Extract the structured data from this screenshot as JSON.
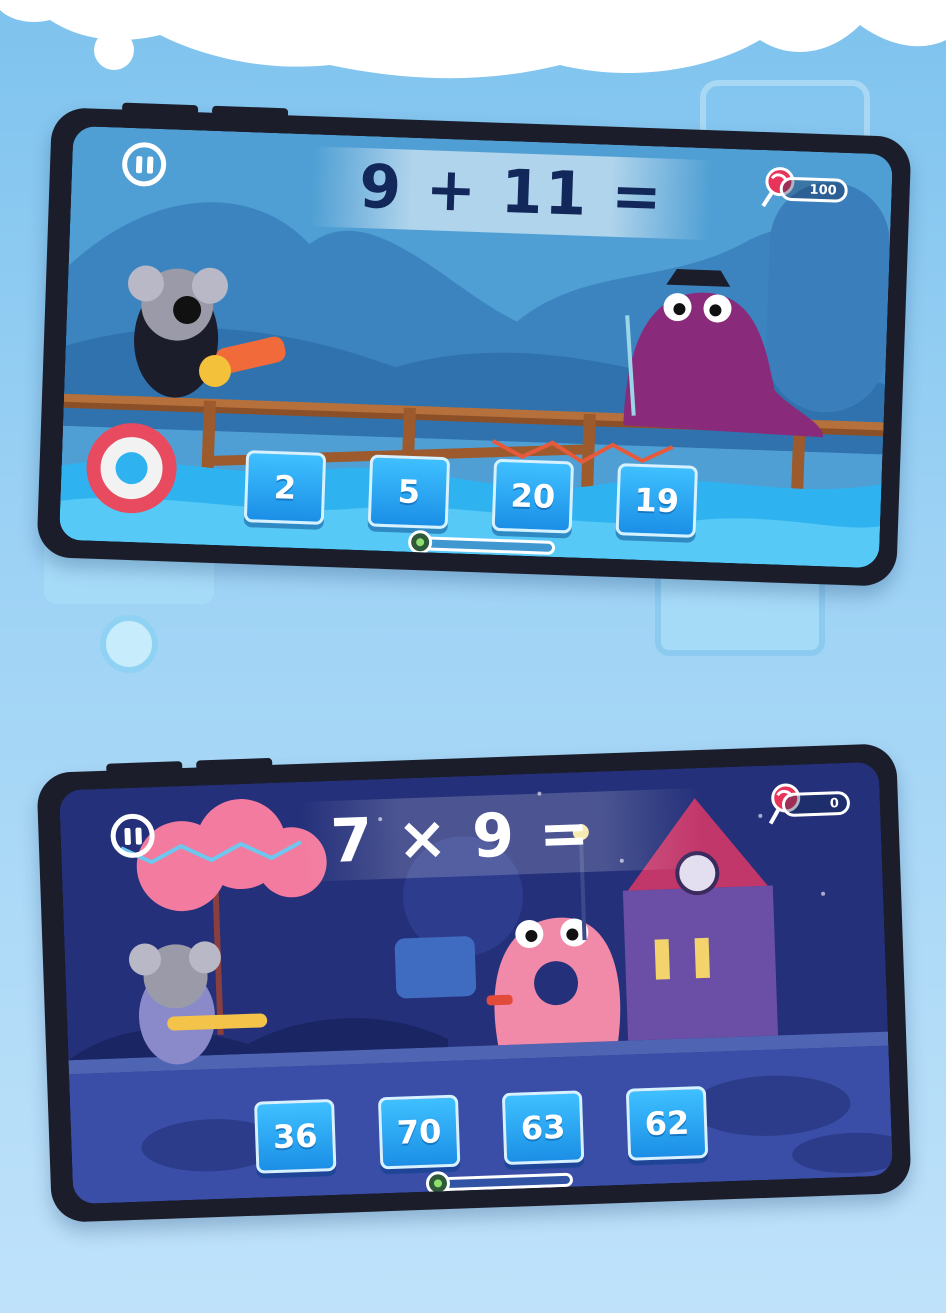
{
  "top_game": {
    "equation": "9 + 11 =",
    "score": "100",
    "answers": [
      "2",
      "5",
      "20",
      "19"
    ],
    "progress": 0.0,
    "equation_color": "#13285a"
  },
  "bottom_game": {
    "equation": "7 × 9 =",
    "score": "0",
    "answers": [
      "36",
      "70",
      "63",
      "62"
    ],
    "progress": 0.0,
    "equation_color": "#ffffff"
  },
  "icons": {
    "pause": "pause-icon",
    "candy": "lollipop-icon",
    "progress": "monster-progress-icon"
  }
}
